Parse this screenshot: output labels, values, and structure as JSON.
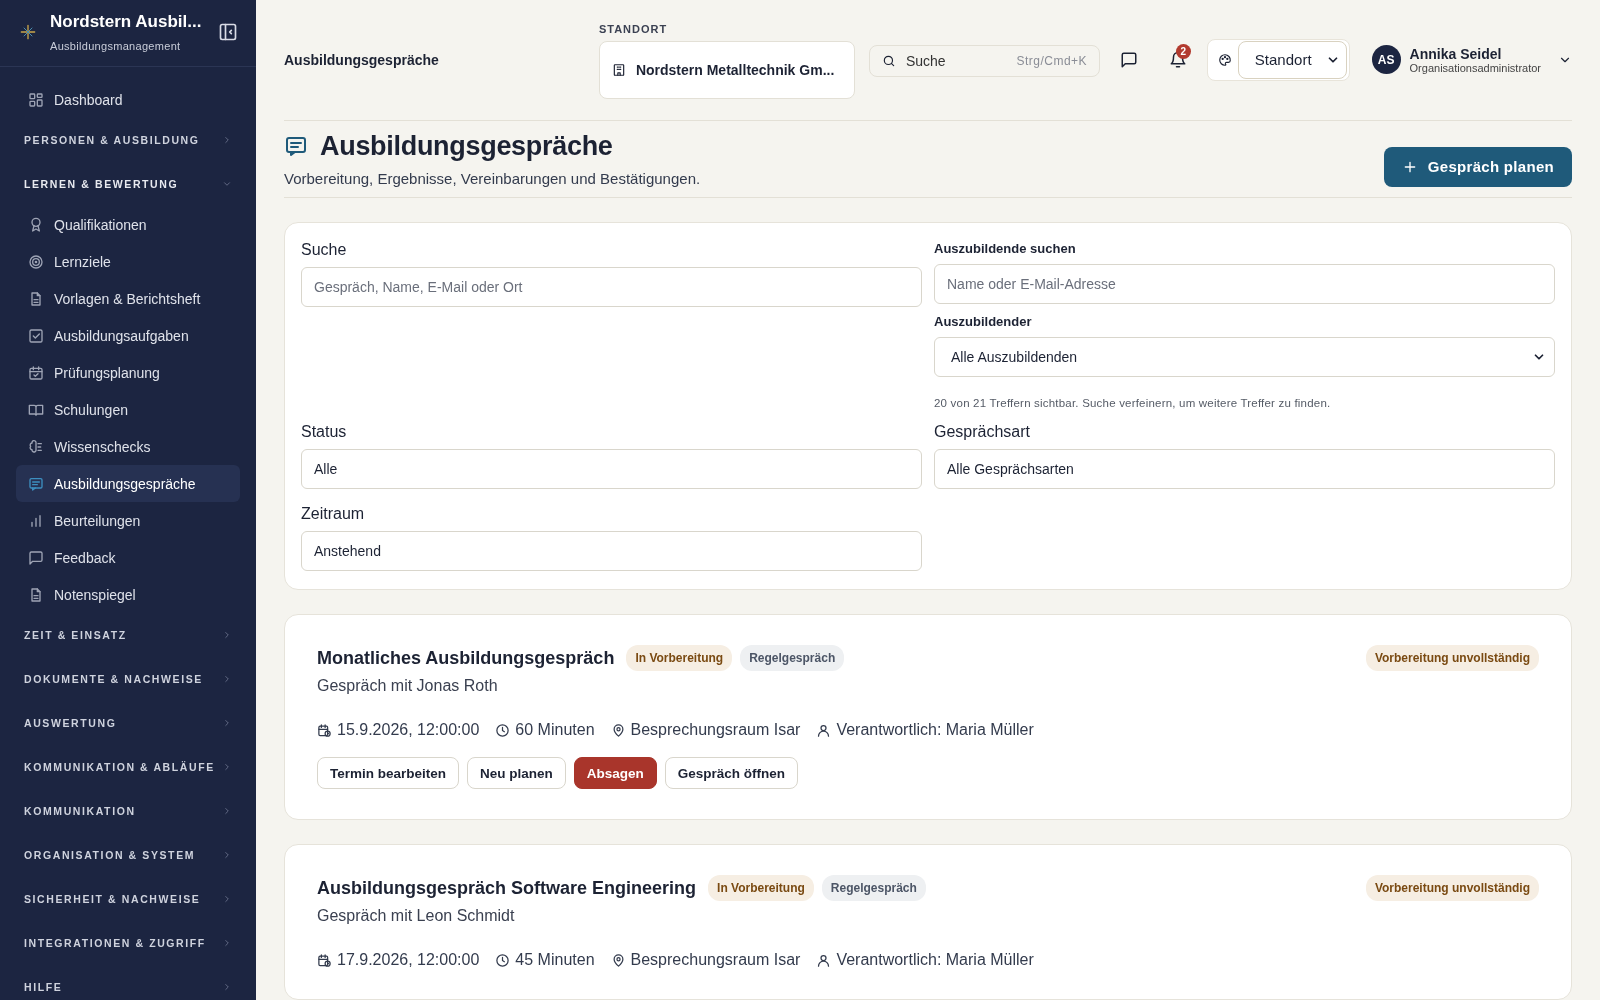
{
  "sidebar": {
    "brand": {
      "title": "Nordstern Ausbil...",
      "subtitle": "Ausbildungsmanagement"
    },
    "nav": [
      {
        "kind": "link",
        "label": "Dashboard",
        "selected": false
      },
      {
        "kind": "group",
        "label": "PERSONEN & AUSBILDUNG",
        "expanded": false
      },
      {
        "kind": "group",
        "label": "LERNEN & BEWERTUNG",
        "expanded": true,
        "children": [
          {
            "kind": "link",
            "label": "Qualifikationen",
            "selected": false
          },
          {
            "kind": "link",
            "label": "Lernziele",
            "selected": false
          },
          {
            "kind": "link",
            "label": "Vorlagen & Berichtsheft",
            "selected": false
          },
          {
            "kind": "link",
            "label": "Ausbildungsaufgaben",
            "selected": false
          },
          {
            "kind": "link",
            "label": "Prüfungsplanung",
            "selected": false
          },
          {
            "kind": "link",
            "label": "Schulungen",
            "selected": false
          },
          {
            "kind": "link",
            "label": "Wissenschecks",
            "selected": false
          },
          {
            "kind": "link",
            "label": "Ausbildungsgespräche",
            "selected": true
          },
          {
            "kind": "link",
            "label": "Beurteilungen",
            "selected": false
          },
          {
            "kind": "link",
            "label": "Feedback",
            "selected": false
          },
          {
            "kind": "link",
            "label": "Notenspiegel",
            "selected": false
          }
        ]
      },
      {
        "kind": "group",
        "label": "ZEIT & EINSATZ",
        "expanded": false
      },
      {
        "kind": "group",
        "label": "DOKUMENTE & NACHWEISE",
        "expanded": false
      },
      {
        "kind": "group",
        "label": "AUSWERTUNG",
        "expanded": false
      },
      {
        "kind": "group",
        "label": "KOMMUNIKATION & ABLÄUFE",
        "expanded": false
      },
      {
        "kind": "group",
        "label": "KOMMUNIKATION",
        "expanded": false
      },
      {
        "kind": "group",
        "label": "ORGANISATION & SYSTEM",
        "expanded": false
      },
      {
        "kind": "group",
        "label": "SICHERHEIT & NACHWEISE",
        "expanded": false
      },
      {
        "kind": "group",
        "label": "INTEGRATIONEN & ZUGRIFF",
        "expanded": false
      },
      {
        "kind": "group",
        "label": "HILFE",
        "expanded": false
      }
    ]
  },
  "header": {
    "title": "Ausbildungsgespräche",
    "location": {
      "label": "STANDORT",
      "value": "Nordstern Metalltechnik Gm..."
    },
    "search": {
      "placeholder": "Suche",
      "shortcut": "Strg/Cmd+K"
    },
    "notifications": "2",
    "theme_select": "Standort",
    "user": {
      "initials": "AS",
      "name": "Annika Seidel",
      "role": "Organisationsadministrator"
    }
  },
  "page": {
    "title": "Ausbildungsgespräche",
    "subtitle": "Vorbereitung, Ergebnisse, Vereinbarungen und Bestätigungen.",
    "primary_action": "Gespräch planen"
  },
  "filters": {
    "search": {
      "label": "Suche",
      "placeholder": "Gespräch, Name, E-Mail oder Ort"
    },
    "trainee_search": {
      "label": "Auszubildende suchen",
      "placeholder": "Name oder E-Mail-Adresse"
    },
    "trainee": {
      "label": "Auszubildender",
      "value": "Alle Auszubildenden"
    },
    "hint": "20 von 21 Treffern sichtbar. Suche verfeinern, um weitere Treffer zu finden.",
    "status": {
      "label": "Status",
      "value": "Alle"
    },
    "type": {
      "label": "Gesprächsart",
      "value": "Alle Gesprächsarten"
    },
    "period": {
      "label": "Zeitraum",
      "value": "Anstehend"
    }
  },
  "conversations": [
    {
      "title": "Monatliches Ausbildungsgespräch",
      "badges": [
        {
          "kind": "status",
          "label": "In Vorbereitung"
        },
        {
          "kind": "type",
          "label": "Regelgespräch"
        }
      ],
      "preparation": "Vorbereitung unvollständig",
      "subtitle": "Gespräch mit Jonas Roth",
      "meta": [
        {
          "kind": "date",
          "text": "15.9.2026, 12:00:00"
        },
        {
          "kind": "duration",
          "text": "60 Minuten"
        },
        {
          "kind": "location",
          "text": "Besprechungsraum Isar"
        },
        {
          "kind": "person",
          "text": "Verantwortlich: Maria Müller"
        }
      ],
      "actions": [
        {
          "kind": "default",
          "label": "Termin bearbeiten"
        },
        {
          "kind": "default",
          "label": "Neu planen"
        },
        {
          "kind": "danger",
          "label": "Absagen"
        },
        {
          "kind": "default",
          "label": "Gespräch öffnen"
        }
      ]
    },
    {
      "title": "Ausbildungsgespräch Software Engineering",
      "badges": [
        {
          "kind": "status",
          "label": "In Vorbereitung"
        },
        {
          "kind": "type",
          "label": "Regelgespräch"
        }
      ],
      "preparation": "Vorbereitung unvollständig",
      "subtitle": "Gespräch mit Leon Schmidt",
      "meta": [
        {
          "kind": "date",
          "text": "17.9.2026, 12:00:00"
        },
        {
          "kind": "duration",
          "text": "45 Minuten"
        },
        {
          "kind": "location",
          "text": "Besprechungsraum Isar"
        },
        {
          "kind": "person",
          "text": "Verantwortlich: Maria Müller"
        }
      ]
    }
  ]
}
